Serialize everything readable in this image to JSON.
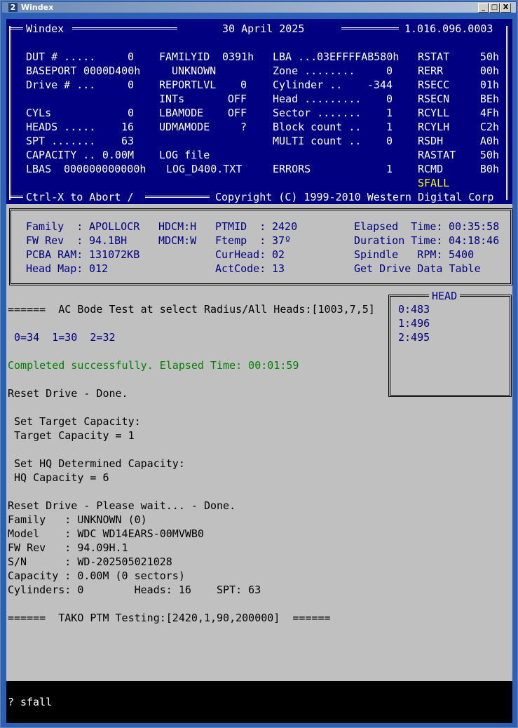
{
  "window": {
    "icon": "2",
    "title": "Windex",
    "btn_min": "_",
    "btn_max": "□",
    "btn_close": "X"
  },
  "header": {
    "app_name": "Windex",
    "date": "30 April 2025",
    "version": "1.016.096.0003",
    "col1": [
      {
        "label": "DUT # .....",
        "value": "0"
      },
      {
        "label": "BASEPORT",
        "value": "0000D400h"
      },
      {
        "label": "Drive # ...",
        "value": "0"
      },
      {
        "label": "",
        "value": ""
      },
      {
        "label": "CYLs",
        "value": "0"
      },
      {
        "label": "HEADS .....",
        "value": "16"
      },
      {
        "label": "SPT .......",
        "value": "63"
      },
      {
        "label": "CAPACITY ..",
        "value": "0.00M"
      },
      {
        "label": "LBAS",
        "value": "000000000000h"
      }
    ],
    "col2": [
      {
        "label": "FAMILYID",
        "value": "0391h"
      },
      {
        "label": "",
        "value": "UNKNOWN"
      },
      {
        "label": "REPORTLVL",
        "value": "0"
      },
      {
        "label": "INTs",
        "value": "OFF"
      },
      {
        "label": "LBAMODE",
        "value": "OFF"
      },
      {
        "label": "UDMAMODE",
        "value": "?"
      },
      {
        "label": "",
        "value": ""
      },
      {
        "label": "LOG file",
        "value": ""
      },
      {
        "label": "",
        "value": "LOG_D400.TXT"
      }
    ],
    "col3": [
      {
        "label": "LBA ...",
        "value": "03EFFFFAB580h"
      },
      {
        "label": "Zone ........",
        "value": "0"
      },
      {
        "label": "Cylinder ..",
        "value": "-344"
      },
      {
        "label": "Head .........",
        "value": "0"
      },
      {
        "label": "Sector .......",
        "value": "1"
      },
      {
        "label": "Block count ..",
        "value": "1"
      },
      {
        "label": "MULTI count ..",
        "value": "0"
      },
      {
        "label": "",
        "value": ""
      },
      {
        "label": "ERRORS",
        "value": "1"
      }
    ],
    "col4": [
      {
        "label": "RSTAT",
        "value": "50h"
      },
      {
        "label": "RERR",
        "value": "00h"
      },
      {
        "label": "RSECC",
        "value": "01h"
      },
      {
        "label": "RSECN",
        "value": "BEh"
      },
      {
        "label": "RCYLL",
        "value": "4Fh"
      },
      {
        "label": "RCYLH",
        "value": "C2h"
      },
      {
        "label": "RSDH",
        "value": "A0h"
      },
      {
        "label": "RASTAT",
        "value": "50h"
      },
      {
        "label": "RCMD",
        "value": "B0h"
      }
    ],
    "sfall": "SFALL",
    "abort": "Ctrl-X to Abort /",
    "copyright": "Copyright (C) 1999-2010 Western Digital Corp"
  },
  "info": {
    "family_label": "Family  :",
    "family": "APOLLOCR",
    "fwrev_label": "FW Rev  :",
    "fwrev": "94.1BH",
    "pcba_label": "PCBA RAM:",
    "pcba": "131072KB",
    "headmap_label": "Head Map:",
    "headmap": "012",
    "hdcm": "HDCM:H",
    "mdcm": "MDCM:W",
    "ptmid_label": "PTMID  :",
    "ptmid": "2420",
    "ftemp_label": "Ftemp  :",
    "ftemp": "37º",
    "curhead_label": "CurHead:",
    "curhead": "02",
    "actcode_label": "ActCode:",
    "actcode": "13",
    "elapsed_label": "Elapsed  Time:",
    "elapsed": "00:35:58",
    "duration_label": "Duration Time:",
    "duration": "04:18:46",
    "spindle_label": "Spindle   RPM:",
    "spindle": "5400",
    "get_table": "Get Drive Data Table"
  },
  "head_panel": {
    "title": "HEAD",
    "rows": [
      "0:483",
      "1:496",
      "2:495"
    ]
  },
  "log": [
    {
      "text": "======  AC Bode Test at select Radius/All Heads:[1003,7,5]",
      "color": "black"
    },
    {
      "text": "",
      "color": "black"
    },
    {
      "text": " 0=34  1=30  2=32",
      "color": "blue"
    },
    {
      "text": "",
      "color": "black"
    },
    {
      "text": "Completed successfully. Elapsed Time: 00:01:59",
      "color": "green"
    },
    {
      "text": "",
      "color": "black"
    },
    {
      "text": "Reset Drive - Done.",
      "color": "black"
    },
    {
      "text": "",
      "color": "black"
    },
    {
      "text": " Set Target Capacity:",
      "color": "black"
    },
    {
      "text": " Target Capacity = 1",
      "color": "black"
    },
    {
      "text": "",
      "color": "black"
    },
    {
      "text": " Set HQ Determined Capacity:",
      "color": "black"
    },
    {
      "text": " HQ Capacity = 6",
      "color": "black"
    },
    {
      "text": "",
      "color": "black"
    },
    {
      "text": "Reset Drive - Please wait... - Done.",
      "color": "black"
    },
    {
      "text": "Family   : UNKNOWN (0)",
      "color": "black"
    },
    {
      "text": "Model    : WDC WD14EARS-00MVWB0",
      "color": "black"
    },
    {
      "text": "FW Rev   : 94.09H.1",
      "color": "black"
    },
    {
      "text": "S/N      : WD-202505021028",
      "color": "black"
    },
    {
      "text": "Capacity : 0.00M (0 sectors)",
      "color": "black"
    },
    {
      "text": "Cylinders: 0        Heads: 16    SPT: 63",
      "color": "black"
    },
    {
      "text": "",
      "color": "black"
    },
    {
      "text": "======  TAKO PTM Testing:[2420,1,90,200000]  ======",
      "color": "black"
    }
  ],
  "command": {
    "prompt": "?",
    "value": "sfall"
  }
}
